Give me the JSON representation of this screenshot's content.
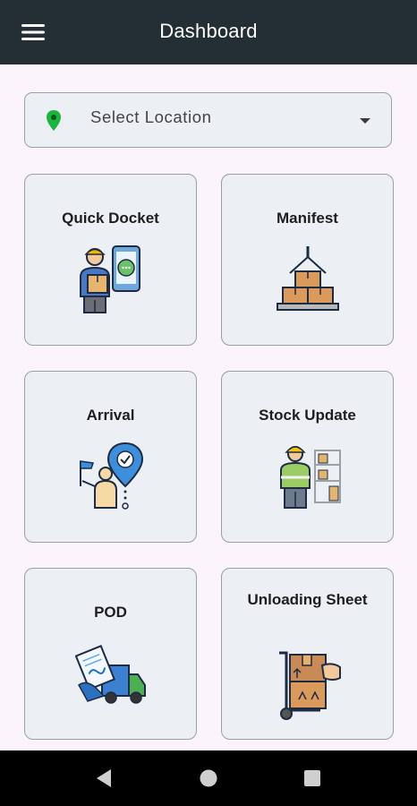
{
  "app": {
    "title": "Dashboard",
    "menu_icon": "hamburger-menu-icon"
  },
  "location": {
    "placeholder": "Select Location",
    "icon": "location-pin-icon",
    "pin_color": "#1db33c",
    "dropdown_icon": "chevron-down-icon"
  },
  "tiles": [
    {
      "label": "Quick Docket",
      "icon": "delivery-man-phone-icon"
    },
    {
      "label": "Manifest",
      "icon": "crane-boxes-icon"
    },
    {
      "label": "Arrival",
      "icon": "arrival-location-icon"
    },
    {
      "label": "Stock Update",
      "icon": "warehouse-worker-icon"
    },
    {
      "label": "POD",
      "icon": "proof-of-delivery-truck-icon"
    },
    {
      "label": "Unloading Sheet",
      "icon": "hand-truck-box-icon"
    }
  ],
  "colors": {
    "appbar": "#232f34",
    "background": "#fbf5fb",
    "card": "#eceff3",
    "card_border": "#9aa0a3"
  },
  "system_nav": {
    "back": "back-triangle-icon",
    "home": "home-circle-icon",
    "recents": "recents-square-icon"
  }
}
